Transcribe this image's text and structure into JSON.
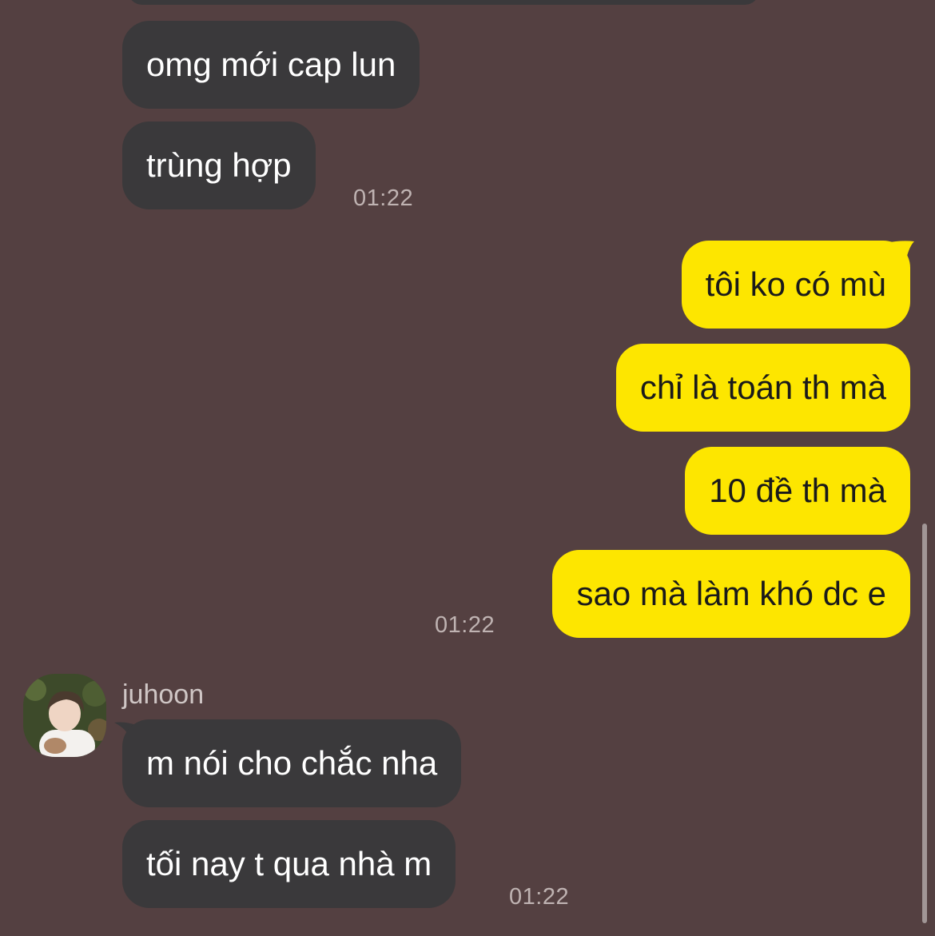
{
  "messages": {
    "block1": {
      "m1": "omg mới cap lun",
      "m2": "trùng hợp",
      "time": "01:22"
    },
    "block2": {
      "m1": "tôi ko có mù",
      "m2": "chỉ là toán th mà",
      "m3": "10 đề th mà",
      "m4": "sao mà làm khó dc e",
      "time": "01:22"
    },
    "block3": {
      "sender": "juhoon",
      "m1": "m nói cho chắc nha",
      "m2": "tối nay t qua nhà m",
      "time": "01:22"
    }
  },
  "colors": {
    "background": "#544041",
    "incoming_bubble": "#3a393b",
    "outgoing_bubble": "#fde600",
    "timestamp": "#bfb3b2"
  },
  "icons": {
    "avatar": "user-avatar-photo"
  }
}
